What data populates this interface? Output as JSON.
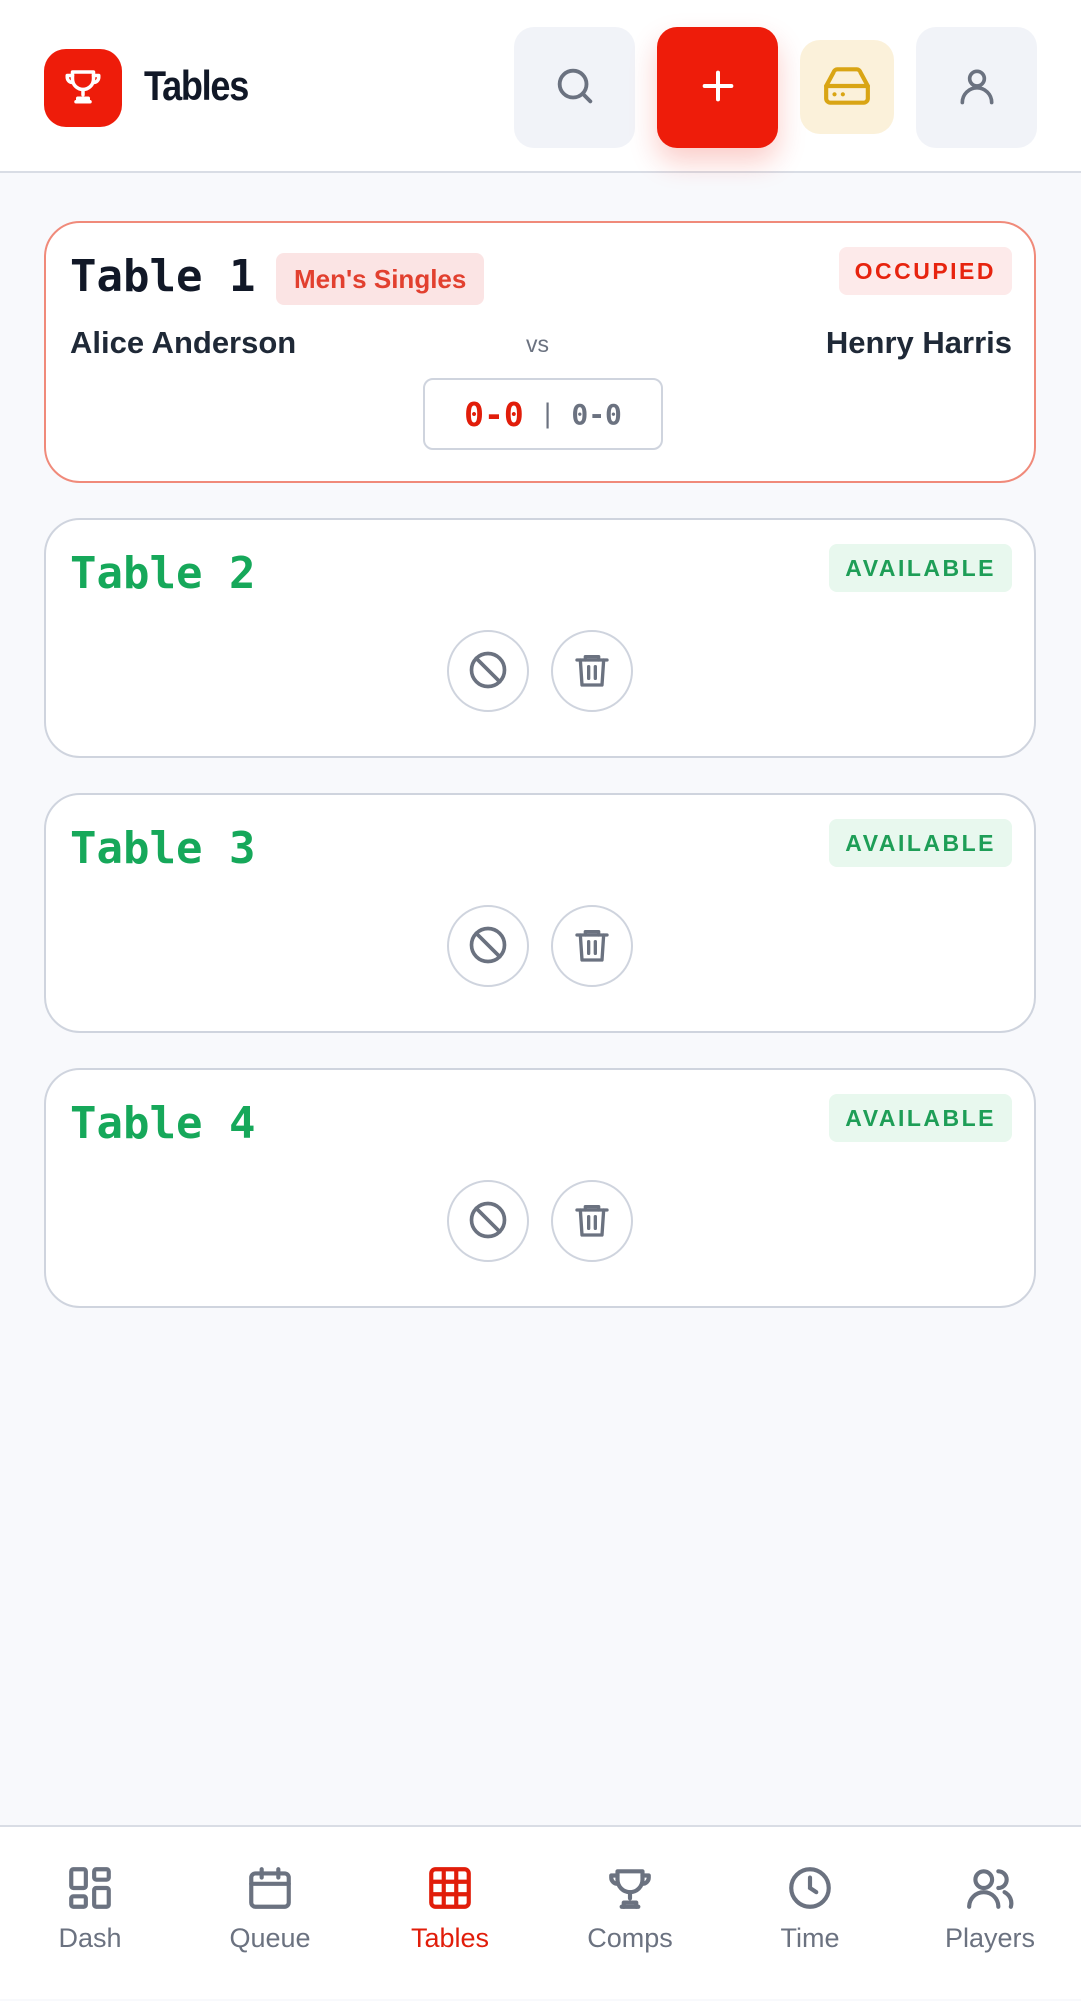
{
  "header": {
    "title": "Tables",
    "logo_icon": "trophy-icon",
    "buttons": {
      "search_icon": "search-icon",
      "add_icon": "plus-icon",
      "drive_icon": "hard-drive-icon",
      "user_icon": "user-icon"
    }
  },
  "tables": [
    {
      "name": "Table 1",
      "status": "OCCUPIED",
      "competition": "Men's Singles",
      "player_left": "Alice Anderson",
      "vs": "vs",
      "player_right": "Henry Harris",
      "score_main": "0-0",
      "score_sep": "|",
      "score_sub": "0-0"
    },
    {
      "name": "Table 2",
      "status": "AVAILABLE"
    },
    {
      "name": "Table 3",
      "status": "AVAILABLE"
    },
    {
      "name": "Table 4",
      "status": "AVAILABLE"
    }
  ],
  "nav": {
    "items": [
      {
        "label": "Dash",
        "icon": "dashboard-icon",
        "active": false
      },
      {
        "label": "Queue",
        "icon": "calendar-icon",
        "active": false
      },
      {
        "label": "Tables",
        "icon": "grid-icon",
        "active": true
      },
      {
        "label": "Comps",
        "icon": "trophy-icon",
        "active": false
      },
      {
        "label": "Time",
        "icon": "clock-icon",
        "active": false
      },
      {
        "label": "Players",
        "icon": "users-icon",
        "active": false
      }
    ]
  },
  "colors": {
    "accent": "#ee1c0a",
    "available": "#16a85a",
    "occupied_border": "#f08a7a",
    "muted": "#6b7280"
  }
}
